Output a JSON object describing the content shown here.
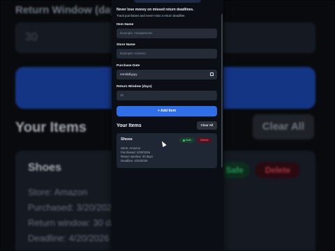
{
  "background": {
    "title": "Return Window (days)",
    "input_value": "30",
    "heading": "Your Items",
    "clear_label": "Clear All",
    "card": {
      "name": "Shoes",
      "store": "Store: Amazon",
      "purchased": "Purchased: 3/20/2026",
      "return_window": "Return window: 30 days",
      "deadline": "Deadline: 4/20/2026",
      "safe_label": "Safe",
      "delete_label": "Delete"
    }
  },
  "app": {
    "tagline": "Never lose money on missed return deadlines.",
    "subtagline": "Track purchases and never miss a return deadline.",
    "form": {
      "item_label": "Item Name",
      "item_placeholder": "Example: Headphones",
      "store_label": "Store Name",
      "store_placeholder": "Example: Amazon",
      "date_label": "Purchase Date",
      "date_value": "mm/dd/yyyy",
      "window_label": "Return Window (days)",
      "window_value": "30",
      "add_button": "+ Add Item"
    },
    "list": {
      "heading": "Your Items",
      "clear_button": "Clear All",
      "items": [
        {
          "name": "Shoes",
          "status": "Safe",
          "delete_label": "Delete",
          "store": "Store: Amazon",
          "purchased": "Purchased: 3/20/2026",
          "return_window": "Return window: 30 days",
          "deadline": "Deadline: 4/20/2026"
        }
      ]
    }
  },
  "colors": {
    "accent": "#2f6ee6",
    "safe": "#2ecc71",
    "danger": "#ff5a70",
    "panel": "#0b0e14",
    "card": "#1f2634"
  }
}
